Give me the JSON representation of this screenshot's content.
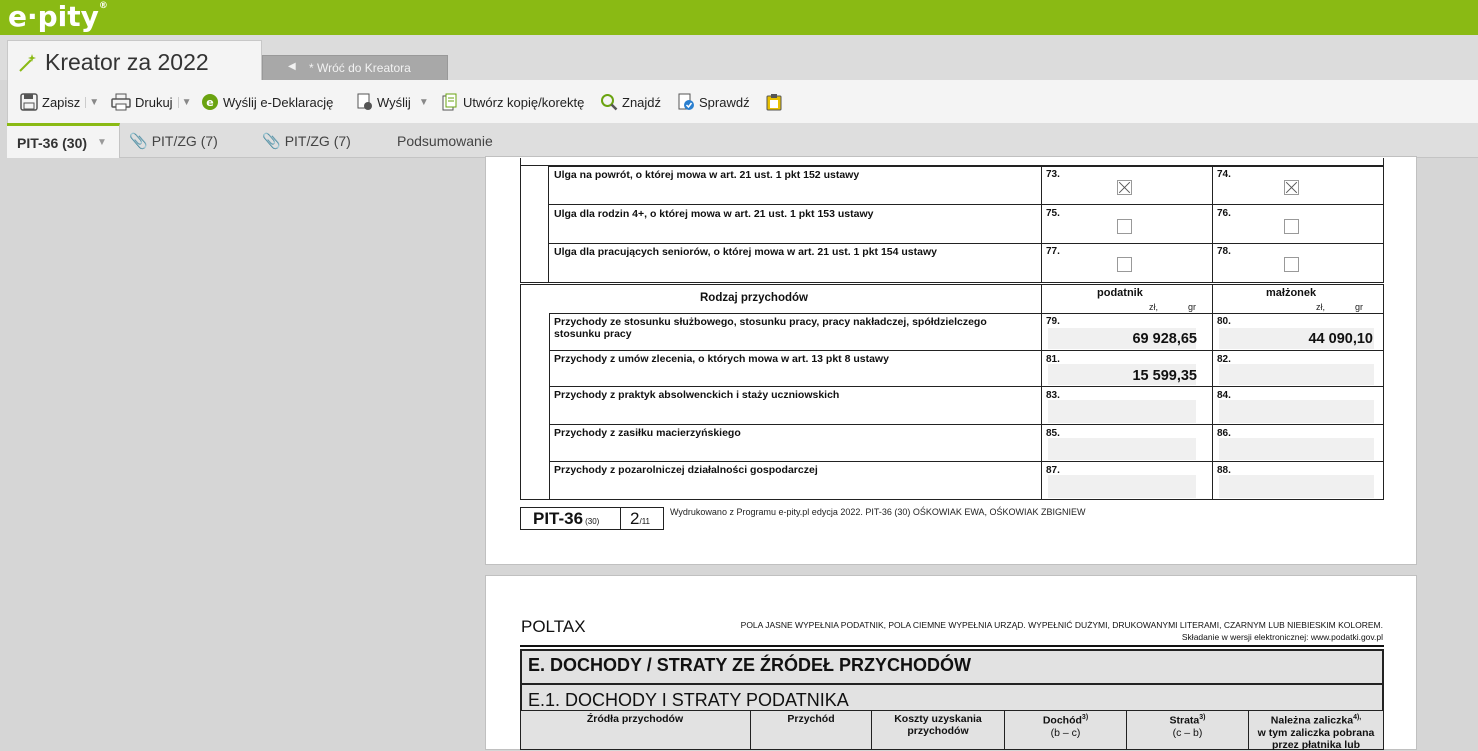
{
  "app": {
    "logo": "e·pity",
    "reg": "®"
  },
  "tabs": {
    "main_title": "Kreator za 2022",
    "back_label": "* Wróć do Kreatora"
  },
  "toolbar": {
    "save": "Zapisz",
    "print": "Drukuj",
    "send_edecl": "Wyślij e-Deklarację",
    "send": "Wyślij",
    "copy": "Utwórz kopię/korektę",
    "find": "Znajdź",
    "check": "Sprawdź"
  },
  "form_tabs": [
    "PIT-36 (30)",
    "PIT/ZG (7)",
    "PIT/ZG (7)",
    "Podsumowanie"
  ],
  "page1": {
    "reliefs": [
      {
        "label": "Ulga na powrót, o której mowa w art. 21 ust. 1 pkt 152 ustawy",
        "n1": "73.",
        "n2": "74."
      },
      {
        "label": "Ulga dla rodzin 4+, o której mowa w art. 21 ust. 1 pkt 153 ustawy",
        "n1": "75.",
        "n2": "76."
      },
      {
        "label": "Ulga dla pracujących seniorów, o której mowa w art. 21 ust. 1 pkt 154 ustawy",
        "n1": "77.",
        "n2": "78."
      }
    ],
    "relief_checked": [
      true,
      false,
      false
    ],
    "income_header": "Rodzaj przychodów",
    "col_taxpayer": "podatnik",
    "col_spouse": "małżonek",
    "unit_zl": "zł,",
    "unit_gr": "gr",
    "incomes": [
      {
        "label": "Przychody ze stosunku służbowego, stosunku pracy, pracy nakładczej, spółdzielczego stosunku pracy",
        "n1": "79.",
        "v1": "69 928,65",
        "n2": "80.",
        "v2": "44 090,10"
      },
      {
        "label": "Przychody z umów zlecenia, o których mowa w art. 13 pkt 8 ustawy",
        "n1": "81.",
        "v1": "15 599,35",
        "n2": "82.",
        "v2": ""
      },
      {
        "label": "Przychody z praktyk absolwenckich i staży uczniowskich",
        "n1": "83.",
        "v1": "",
        "n2": "84.",
        "v2": ""
      },
      {
        "label": "Przychody z zasiłku macierzyńskiego",
        "n1": "85.",
        "v1": "",
        "n2": "86.",
        "v2": ""
      },
      {
        "label": "Przychody z pozarolniczej działalności gospodarczej",
        "n1": "87.",
        "v1": "",
        "n2": "88.",
        "v2": ""
      }
    ],
    "footer_form": "PIT-36",
    "footer_ver": "(30)",
    "footer_page": "2",
    "footer_total": "/11",
    "footer_note": "Wydrukowano z Programu e-pity.pl edycja 2022. PIT-36 (30) OŚKOWIAK EWA, OŚKOWIAK ZBIGNIEW"
  },
  "page2": {
    "poltax": "POLTAX",
    "instr": "POLA JASNE WYPEŁNIA PODATNIK, POLA CIEMNE WYPEŁNIA URZĄD. WYPEŁNIĆ DUŻYMI, DRUKOWANYMI LITERAMI, CZARNYM LUB NIEBIESKIM KOLOREM.",
    "electronic": "Składanie w wersji elektronicznej: www.podatki.gov.pl",
    "section_e": "E. DOCHODY / STRATY ZE ŹRÓDEŁ PRZYCHODÓW",
    "section_e1": "E.1. DOCHODY I STRATY PODATNIKA",
    "cols": [
      "Źródła przychodów",
      "Przychód",
      "Koszty uzyskania przychodów",
      "Dochód",
      "Strata",
      "Należna zaliczka"
    ],
    "col_sup": {
      "income": "3)",
      "loss": "3)",
      "advance": "4),"
    },
    "col_sub": {
      "income": "(b – c)",
      "loss": "(c – b)",
      "advance_line2": "w tym zaliczka pobrana",
      "advance_line3": "przez płatnika lub"
    }
  }
}
